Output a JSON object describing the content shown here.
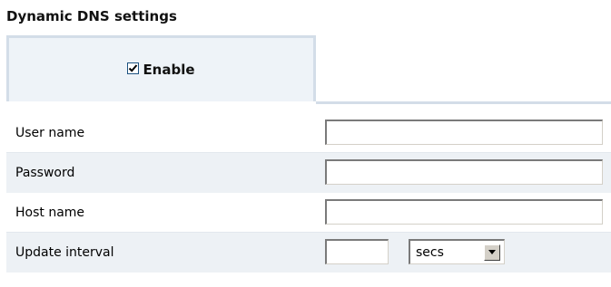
{
  "section": {
    "title": "Dynamic DNS settings"
  },
  "tab": {
    "enable_label": "Enable",
    "enable_checked": true
  },
  "fields": {
    "user_name": {
      "label": "User name",
      "value": ""
    },
    "password": {
      "label": "Password",
      "value": ""
    },
    "host_name": {
      "label": "Host name",
      "value": ""
    },
    "update_interval": {
      "label": "Update interval",
      "value": "",
      "unit": "secs"
    }
  },
  "colors": {
    "tab_bg": "#eef3f8",
    "tab_border": "#d3dde8",
    "row_shade": "#edf1f5"
  },
  "icons": {
    "enable": "checkbox-checked-icon",
    "dropdown": "chevron-down-icon"
  }
}
